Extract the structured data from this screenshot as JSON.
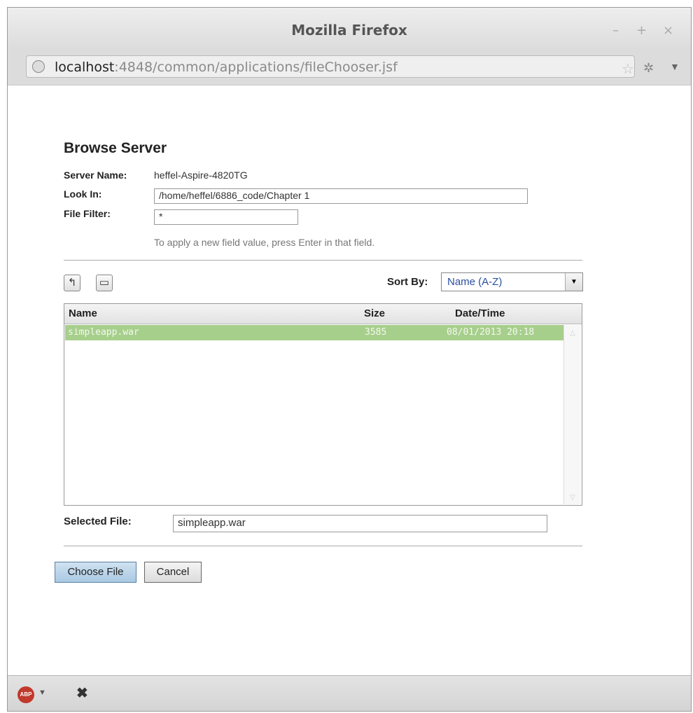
{
  "window": {
    "title": "Mozilla Firefox",
    "controls": {
      "minimize": "–",
      "maximize": "+",
      "close": "×"
    }
  },
  "urlbar": {
    "host": "localhost",
    "rest": ":4848/common/applications/fileChooser.jsf"
  },
  "page": {
    "heading": "Browse Server",
    "server_name_label": "Server Name:",
    "server_name_value": "heffel-Aspire-4820TG",
    "look_in_label": "Look In:",
    "look_in_value": "/home/heffel/6886_code/Chapter 1",
    "file_filter_label": "File Filter:",
    "file_filter_value": "*",
    "hint": "To apply a new field value, press Enter in that field.",
    "sort_by_label": "Sort By:",
    "sort_by_value": "Name (A-Z)",
    "columns": [
      "Name",
      "Size",
      "Date/Time"
    ],
    "rows": [
      {
        "name": "simpleapp.war",
        "size": "3585",
        "datetime": "08/01/2013 20:18"
      }
    ],
    "selected_file_label": "Selected File:",
    "selected_file_value": "simpleapp.war",
    "choose_button": "Choose File",
    "cancel_button": "Cancel"
  },
  "statusbar": {
    "abp_label": "ABP"
  },
  "icons": [
    "globe-icon",
    "bookmark-star-icon",
    "addon-icon",
    "menu-arrow-icon",
    "up-folder-icon",
    "new-folder-icon",
    "dropdown-arrow-icon",
    "scroll-up-icon",
    "scroll-down-icon",
    "adblock-icon",
    "close-x-icon"
  ],
  "colors": {
    "selected_row": "#a7cf8c",
    "choose_button_bg": "#b8d4ea",
    "sort_text": "#2a4fa0"
  }
}
